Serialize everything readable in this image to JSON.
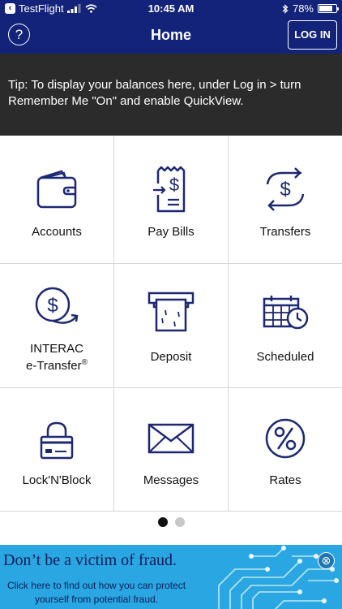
{
  "status_bar": {
    "back_app": "TestFlight",
    "time": "10:45 AM",
    "battery": "78%",
    "battery_level": 0.78
  },
  "nav": {
    "title": "Home",
    "help_icon": "?",
    "login_label": "LOG IN"
  },
  "tip": {
    "text": "Tip: To display your balances here, under Log in > turn Remember Me \"On\" and enable QuickView."
  },
  "tiles": {
    "accounts": "Accounts",
    "pay_bills": "Pay Bills",
    "transfers": "Transfers",
    "interac_line1": "INTERAC",
    "interac_line2": "e-Transfer",
    "interac_reg": "®",
    "deposit": "Deposit",
    "scheduled": "Scheduled",
    "lock_block": "Lock'N'Block",
    "messages": "Messages",
    "rates": "Rates"
  },
  "pager": {
    "pages": 2,
    "active": 1
  },
  "banner": {
    "headline": "Don’t be a victim of fraud.",
    "sub_line1": "Click here to find out how you can protect",
    "sub_line2": "yourself from potential fraud.",
    "close_icon": "⊗"
  },
  "colors": {
    "navy": "#14237a",
    "tip_bg": "#2b2b2b",
    "icon_navy": "#1c2872",
    "banner_bg": "#2aa7e3"
  }
}
